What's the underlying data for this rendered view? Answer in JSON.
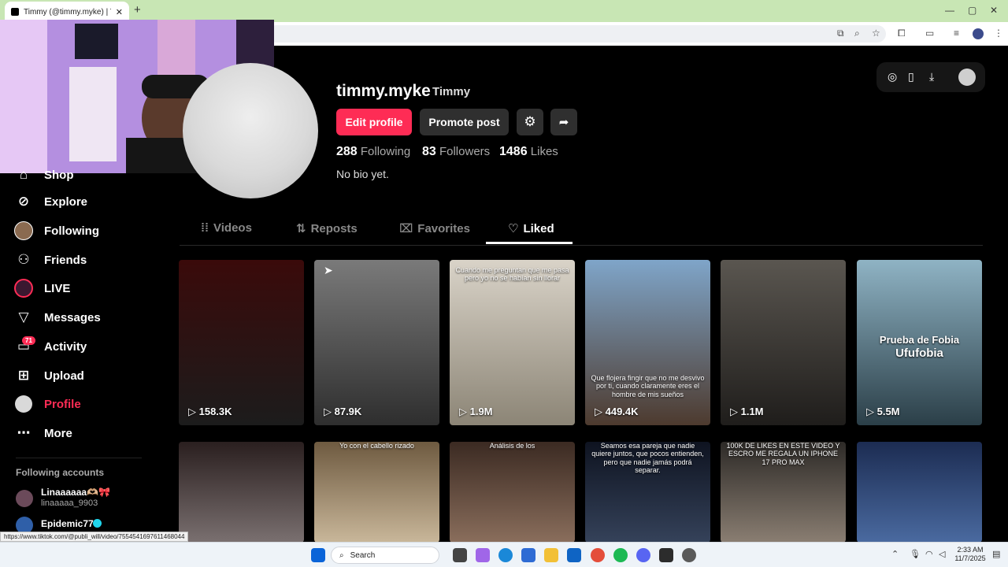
{
  "browser": {
    "tab_title": "Timmy (@timmy.myke) | TikTok",
    "new_tab_symbol": "+",
    "status_link": "https://www.tiktok.com/@publi_will/video/7554541697611468044"
  },
  "top_actions": {
    "icons": [
      "tiktok-coin-icon",
      "phone-icon",
      "download-icon",
      "avatar-small"
    ]
  },
  "sidebar": {
    "items": [
      {
        "label": "Shop",
        "icon": "shop-icon"
      },
      {
        "label": "Explore",
        "icon": "compass-icon"
      },
      {
        "label": "Following",
        "icon": "following-avatar"
      },
      {
        "label": "Friends",
        "icon": "friends-icon"
      },
      {
        "label": "LIVE",
        "icon": "live-icon"
      },
      {
        "label": "Messages",
        "icon": "send-icon"
      },
      {
        "label": "Activity",
        "icon": "message-icon"
      },
      {
        "label": "Upload",
        "icon": "plus-square-icon"
      },
      {
        "label": "Profile",
        "icon": "profile-avatar"
      },
      {
        "label": "More",
        "icon": "more-icon"
      }
    ],
    "activity_badge": "71",
    "following_accounts_title": "Following accounts",
    "accounts": [
      {
        "name": "Linaaaaaa🫶🏼🎀",
        "handle": "linaaaaa_9903"
      },
      {
        "name": "Epidemic77",
        "handle": ""
      }
    ]
  },
  "profile": {
    "username": "timmy.myke",
    "nickname": "Timmy",
    "edit_label": "Edit profile",
    "promote_label": "Promote post",
    "following_count": "288",
    "following_label": "Following",
    "followers_count": "83",
    "followers_label": "Followers",
    "likes_count": "1486",
    "likes_label": "Likes",
    "bio": "No bio yet."
  },
  "tabs": [
    {
      "label": "Videos",
      "icon": "grid-icon"
    },
    {
      "label": "Reposts",
      "icon": "repost-icon"
    },
    {
      "label": "Favorites",
      "icon": "bookmark-icon"
    },
    {
      "label": "Liked",
      "icon": "heart-outline-icon",
      "active": true
    }
  ],
  "videos": [
    {
      "views": "158.3K",
      "overlay": "",
      "colors": [
        "#3a0a0a",
        "#1c1c1c"
      ]
    },
    {
      "views": "87.9K",
      "overlay": "",
      "colors": [
        "#7a7a7a",
        "#2e2e2e"
      ]
    },
    {
      "views": "1.9M",
      "overlay": "Cuando me preguntan que me pasa pero yo no se habían sin llorar",
      "colors": [
        "#d9d3c8",
        "#8c8576"
      ]
    },
    {
      "views": "449.4K",
      "overlay": "Que flojera fingir que no me desvivo por ti, cuando claramente eres el hombre de mis sueños",
      "colors": [
        "#7fa5c9",
        "#4d3a2e"
      ]
    },
    {
      "views": "1.1M",
      "overlay": "",
      "colors": [
        "#5a5650",
        "#1f1d1b"
      ]
    },
    {
      "views": "5.5M",
      "overlay": "Prueba de Fobia",
      "overlay2": "Ufufobia",
      "colors": [
        "#8fb3c4",
        "#2b3f48"
      ]
    },
    {
      "views": "",
      "overlay": "",
      "colors": [
        "#2a1f1f",
        "#7a7070"
      ]
    },
    {
      "views": "",
      "overlay": "Yo con el cabello rizado",
      "colors": [
        "#6e5a40",
        "#c9b79a"
      ]
    },
    {
      "views": "",
      "overlay": "Análisis de los",
      "colors": [
        "#3b2a22",
        "#8a6e5c"
      ]
    },
    {
      "views": "",
      "overlay": "Seamos esa pareja que nadie quiere juntos, que pocos entienden, pero que nadie jamás podrá separar.",
      "colors": [
        "#0e1320",
        "#35425a"
      ]
    },
    {
      "views": "",
      "overlay": "100K DE LIKES EN ESTE VIDEO Y ESCRO ME REGALA UN IPHONE 17 PRO MAX",
      "colors": [
        "#2d2a27",
        "#8a7e72"
      ]
    },
    {
      "views": "",
      "overlay": "",
      "colors": [
        "#1c2c52",
        "#4a6aa0"
      ]
    }
  ],
  "taskbar": {
    "search_label": "Search",
    "time": "2:33 AM",
    "date": "11/7/2025"
  }
}
